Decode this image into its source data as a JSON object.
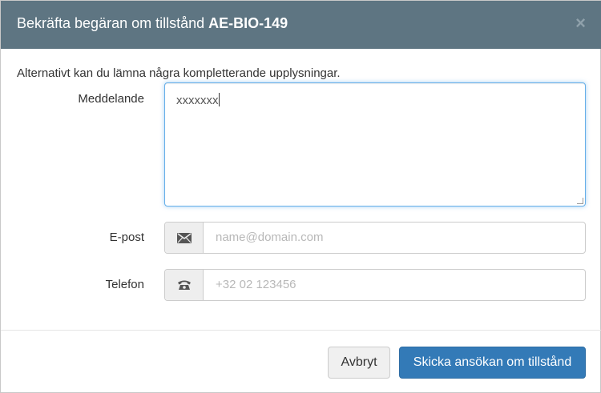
{
  "header": {
    "title_prefix": "Bekräfta begäran om tillstånd ",
    "title_code": "AE-BIO-149",
    "close_glyph": "×"
  },
  "form": {
    "intro": "Alternativt kan du lämna några kompletterande upplysningar.",
    "message_label": "Meddelande",
    "message_value": "xxxxxxx",
    "email_label": "E-post",
    "email_placeholder": "name@domain.com",
    "email_icon": "envelope-icon",
    "phone_label": "Telefon",
    "phone_placeholder": "+32 02 123456",
    "phone_icon": "phone-icon"
  },
  "footer": {
    "cancel_label": "Avbryt",
    "submit_label": "Skicka ansökan om tillstånd"
  },
  "colors": {
    "header_bg": "#5e7582",
    "primary": "#337ab7",
    "focus_border": "#66afe9"
  }
}
